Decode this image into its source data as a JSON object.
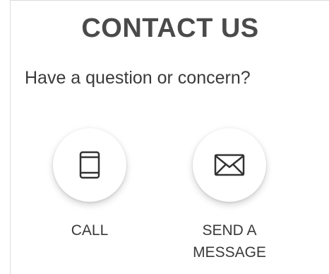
{
  "contact": {
    "title": "CONTACT US",
    "subtitle": "Have a question or concern?",
    "actions": [
      {
        "icon": "phone-icon",
        "label_lines": [
          "CALL"
        ]
      },
      {
        "icon": "envelope-icon",
        "label_lines": [
          "SEND A",
          "MESSAGE"
        ]
      }
    ]
  }
}
